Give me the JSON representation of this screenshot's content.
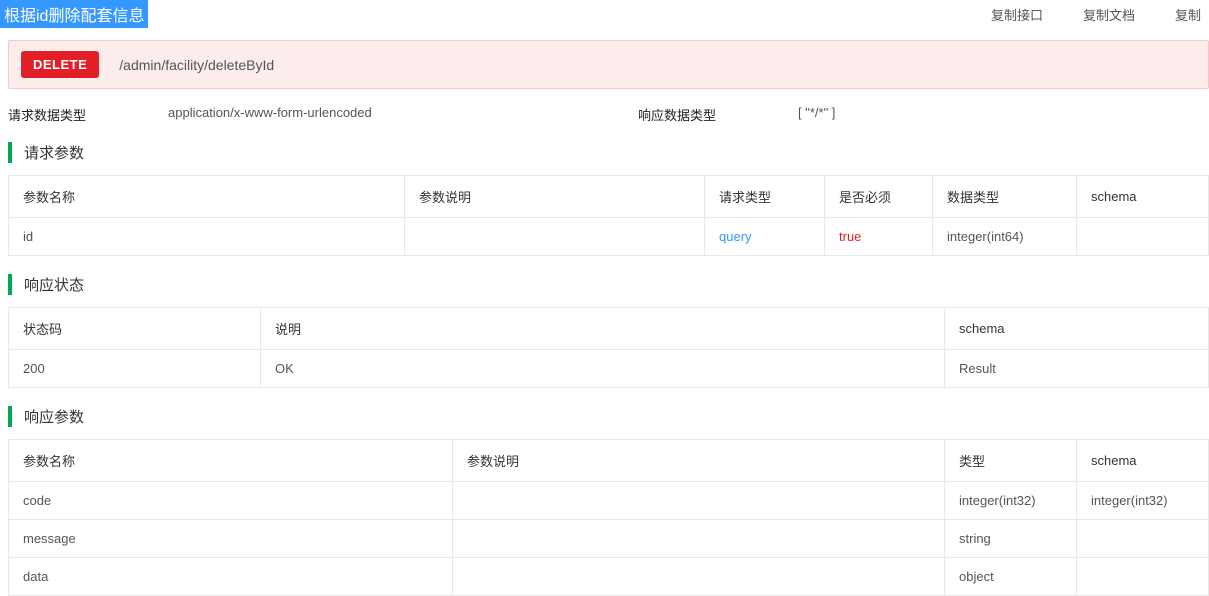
{
  "header": {
    "title": "根据id删除配套信息",
    "actions": [
      "复制接口",
      "复制文档",
      "复制"
    ]
  },
  "endpoint": {
    "method": "DELETE",
    "path": "/admin/facility/deleteById"
  },
  "meta": {
    "request_type_label": "请求数据类型",
    "request_type_value": "application/x-www-form-urlencoded",
    "response_type_label": "响应数据类型",
    "response_type_value": "[ \"*/*\" ]"
  },
  "sections": {
    "request_params": {
      "title": "请求参数",
      "headers": [
        "参数名称",
        "参数说明",
        "请求类型",
        "是否必须",
        "数据类型",
        "schema"
      ],
      "rows": [
        {
          "name": "id",
          "desc": "",
          "req_type": "query",
          "required": "true",
          "data_type": "integer(int64)",
          "schema": ""
        }
      ]
    },
    "response_status": {
      "title": "响应状态",
      "headers": [
        "状态码",
        "说明",
        "schema"
      ],
      "rows": [
        {
          "code": "200",
          "desc": "OK",
          "schema": "Result"
        }
      ]
    },
    "response_params": {
      "title": "响应参数",
      "headers": [
        "参数名称",
        "参数说明",
        "类型",
        "schema"
      ],
      "rows": [
        {
          "name": "code",
          "desc": "",
          "type": "integer(int32)",
          "schema": "integer(int32)"
        },
        {
          "name": "message",
          "desc": "",
          "type": "string",
          "schema": ""
        },
        {
          "name": "data",
          "desc": "",
          "type": "object",
          "schema": ""
        }
      ]
    }
  }
}
